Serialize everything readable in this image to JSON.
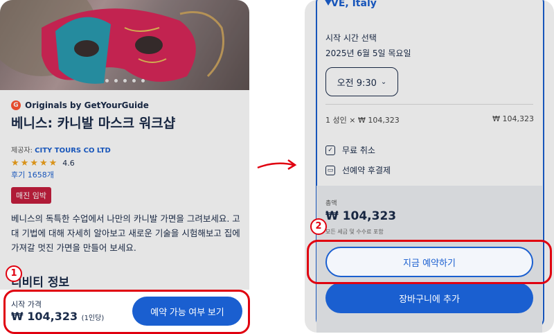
{
  "left": {
    "brand": "Originals by GetYourGuide",
    "brand_logo": "G",
    "title": "베니스: 카니발 마스크 워크샵",
    "provider_label": "제공자:",
    "provider_name": "CITY TOURS CO LTD",
    "rating": "4.6",
    "reviews": "후기 1658개",
    "badge": "매진 임박",
    "description": "베니스의 독특한 수업에서 나만의 카니발 가면을 그려보세요. 고대 기법에 대해 자세히 알아보고 새로운 기술을 시험해보고 집에 가져갈 멋진 가면을 만들어 보세요.",
    "section": "티비티 정보",
    "start_label": "시작 가격",
    "start_price": "₩ 104,323",
    "per_person": "(1인당)",
    "check_button": "예약 가능 여부 보기",
    "marker": "1"
  },
  "right": {
    "location": "VE, Italy",
    "time_label": "시작 시간 선택",
    "date": "2025년 6월 5일 목요일",
    "time_value": "오전 9:30",
    "adult_line": "1 성인 × ₩ 104,323",
    "adult_price": "₩ 104,323",
    "feature1": "무료 취소",
    "feature2": "선예약 후결제",
    "total_label": "총액",
    "total_price": "₩ 104,323",
    "tax_note": "모든 세금 및 수수료 포함",
    "book_button": "지금 예약하기",
    "cart_button": "장바구니에 추가",
    "marker": "2"
  },
  "colors": {
    "accent": "#1a5fd0",
    "highlight": "#e0000f",
    "badge": "#c41f3e",
    "star": "#f1a31e"
  }
}
